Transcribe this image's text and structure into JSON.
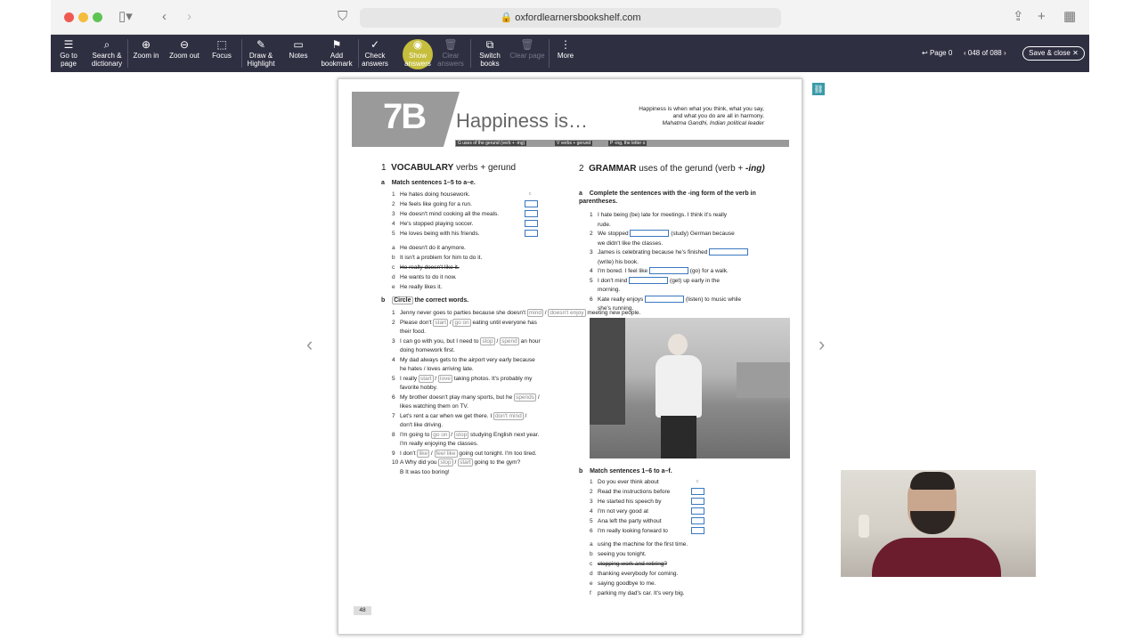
{
  "browser": {
    "url": "oxfordlearnersbookshelf.com"
  },
  "toolbar": {
    "items": [
      {
        "label1": "Go to",
        "label2": "page",
        "icon": "list-icon"
      },
      {
        "label1": "Search &",
        "label2": "dictionary",
        "icon": "search-icon"
      },
      {
        "label1": "Zoom in",
        "label2": "",
        "icon": "zoom-in-icon"
      },
      {
        "label1": "Zoom out",
        "label2": "",
        "icon": "zoom-out-icon"
      },
      {
        "label1": "Focus",
        "label2": "",
        "icon": "focus-icon"
      },
      {
        "label1": "Draw &",
        "label2": "Highlight",
        "icon": "pen-icon"
      },
      {
        "label1": "Notes",
        "label2": "",
        "icon": "note-icon"
      },
      {
        "label1": "Add",
        "label2": "bookmark",
        "icon": "bookmark-icon"
      },
      {
        "label1": "Check",
        "label2": "answers",
        "icon": "check-icon"
      },
      {
        "label1": "Show",
        "label2": "answers",
        "icon": "eye-icon"
      },
      {
        "label1": "Clear",
        "label2": "answers",
        "icon": "trash-icon"
      },
      {
        "label1": "Switch",
        "label2": "books",
        "icon": "books-icon"
      },
      {
        "label1": "Clear page",
        "label2": "",
        "icon": "trash-icon"
      },
      {
        "label1": "More",
        "label2": "",
        "icon": "more-icon"
      }
    ],
    "page_back": "Page 0",
    "page_counter": "048 of 088",
    "save_close": "Save & close"
  },
  "book": {
    "unit": "7B",
    "title": "Happiness is…",
    "quote": "Happiness is when what you think, what you say, and what you do are all in harmony.",
    "quote_author": "Mahatma Gandhi, Indian political leader",
    "tags": [
      "G uses of the gerund (verb + -ing)",
      "V verbs + gerund",
      "P -ing, the letter o"
    ],
    "vocab": {
      "num": "1",
      "title": "VOCABULARY",
      "title_rest": "verbs + gerund",
      "a_letter": "a",
      "a_instr": "Match sentences 1–5 to a–e.",
      "sentences": [
        "He hates doing housework.",
        "He feels like going for a run.",
        "He doesn't mind cooking all the meals.",
        "He's stopped playing soccer.",
        "He loves being with his friends."
      ],
      "example_answer": "c",
      "options": [
        {
          "l": "a",
          "t": "He doesn't do it anymore."
        },
        {
          "l": "b",
          "t": "It isn't a problem for him to do it."
        },
        {
          "l": "c",
          "t": "He really doesn't like it."
        },
        {
          "l": "d",
          "t": "He wants to do it now."
        },
        {
          "l": "e",
          "t": "He really likes it."
        }
      ],
      "b_letter": "b",
      "b_instr_circle": "Circle",
      "b_instr": "the correct words.",
      "items": [
        {
          "n": "1",
          "pre": "Jenny never goes to parties because she doesn't",
          "w1": "mind",
          "w2": "doesn't enjoy",
          "post": "meeting new people.",
          "l2": ""
        },
        {
          "n": "2",
          "pre": "Please don't",
          "w1": "start",
          "w2": "go on",
          "post": "eating until everyone has",
          "l2": "their food."
        },
        {
          "n": "3",
          "pre": "I can go with you, but I need to",
          "w1": "stop",
          "w2": "spend",
          "post": "an hour",
          "l2": "doing homework first."
        },
        {
          "n": "4",
          "pre": "My dad always gets to the airport very early because",
          "w1": "",
          "w2": "",
          "post": "",
          "l2": "he hates / loves arriving late."
        },
        {
          "n": "5",
          "pre": "I really",
          "w1": "start",
          "w2": "love",
          "post": "taking photos. It's probably my",
          "l2": "favorite hobby."
        },
        {
          "n": "6",
          "pre": "My brother doesn't play many sports, but he",
          "w1": "spends",
          "w2": "",
          "post": "/",
          "l2": "likes watching them on TV."
        },
        {
          "n": "7",
          "pre": "Let's rent a car when we get there. I",
          "w1": "don't mind",
          "w2": "",
          "post": "/",
          "l2": "don't like driving."
        },
        {
          "n": "8",
          "pre": "I'm going to",
          "w1": "go on",
          "w2": "stop",
          "post": "studying English next year.",
          "l2": "I'm really enjoying the classes."
        },
        {
          "n": "9",
          "pre": "I don't",
          "w1": "like",
          "w2": "feel like",
          "post": "going out tonight. I'm too tired.",
          "l2": ""
        },
        {
          "n": "10",
          "pre": "A  Why did you",
          "w1": "stop",
          "w2": "start",
          "post": "going to the gym?",
          "l2": "B  It was too boring!"
        }
      ]
    },
    "grammar": {
      "num": "2",
      "title": "GRAMMAR",
      "title_rest": "uses of the gerund (verb +",
      "title_rest2": "-ing)",
      "a_letter": "a",
      "a_instr": "Complete the sentences with the -ing form of the verb in parentheses.",
      "items": [
        {
          "n": "1",
          "l1": "I hate being (be) late for meetings. I think it's really",
          "l2": "rude."
        },
        {
          "n": "2",
          "l1": "We stopped",
          "l1b": "(study) German because",
          "l2": "we didn't like the classes."
        },
        {
          "n": "3",
          "l1": "James is celebrating because he's finished",
          "l1b": "",
          "l2": "(write) his book."
        },
        {
          "n": "4",
          "l1": "I'm bored. I feel like",
          "l1b": "(go) for a walk.",
          "l2": ""
        },
        {
          "n": "5",
          "l1": "I don't mind",
          "l1b": "(get) up early in the",
          "l2": "morning."
        },
        {
          "n": "6",
          "l1": "Kate really enjoys",
          "l1b": "(listen) to music while",
          "l2": "she's running."
        }
      ],
      "b_letter": "b",
      "b_instr": "Match sentences 1–6 to a–f.",
      "b_sentences": [
        "Do you ever think about",
        "Read the instructions before",
        "He started his speech by",
        "I'm not very good at",
        "Ana left the party without",
        "I'm really looking forward to"
      ],
      "b_example": "c",
      "b_options": [
        {
          "l": "a",
          "t": "using the machine for the first time."
        },
        {
          "l": "b",
          "t": "seeing you tonight."
        },
        {
          "l": "c",
          "t": "stopping work and retiring?"
        },
        {
          "l": "d",
          "t": "thanking everybody for coming."
        },
        {
          "l": "e",
          "t": "saying goodbye to me."
        },
        {
          "l": "f",
          "t": "parking my dad's car. It's very big."
        }
      ]
    },
    "page_number": "48"
  },
  "colors": {
    "toolbar": "#2f2f42",
    "answer_box": "#3a78c0",
    "highlight": "#e1d73c"
  }
}
